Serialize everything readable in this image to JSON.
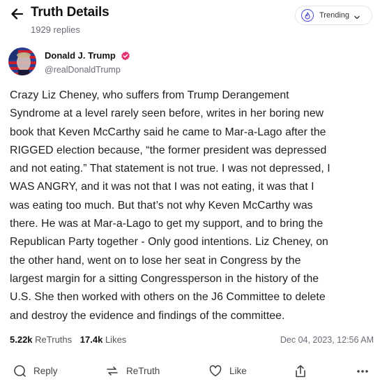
{
  "header": {
    "title": "Truth Details",
    "replies": "1929 replies",
    "trending_label": "Trending"
  },
  "author": {
    "name": "Donald J. Trump",
    "handle": "@realDonaldTrump"
  },
  "post": {
    "lines": [
      "Crazy Liz Cheney, who suffers from Trump Derangement",
      "Syndrome at a level rarely seen before, writes in her boring new",
      "book that Keven McCarthy said he came to Mar-a-Lago after the",
      "RIGGED election because, “the former president was depressed",
      "and not eating.” That statement is not true. I was not depressed, I",
      "WAS ANGRY, and it was not that I was not eating, it was that I",
      "was eating too much. But that’s not why Keven McCarthy was",
      "there. He was at Mar-a-Lago to get my support, and to bring the",
      "Republican Party together - Only good intentions. Liz Cheney, on",
      "the other hand, went on to lose her seat in Congress by the",
      "largest margin for a sitting Congressperson in the history of the",
      "U.S. She then worked with others on the J6 Committee to delete",
      "and destroy the evidence and findings of the committee."
    ]
  },
  "stats": {
    "retruths_count": "5.22k",
    "retruths_label": "ReTruths",
    "likes_count": "17.4k",
    "likes_label": "Likes",
    "timestamp": "Dec 04, 2023, 12:56 AM"
  },
  "actions": {
    "reply": "Reply",
    "retruth": "ReTruth",
    "like": "Like"
  },
  "colors": {
    "accent": "#4b4cdb",
    "verified": "#e0306f",
    "muted": "#6b6b78"
  }
}
